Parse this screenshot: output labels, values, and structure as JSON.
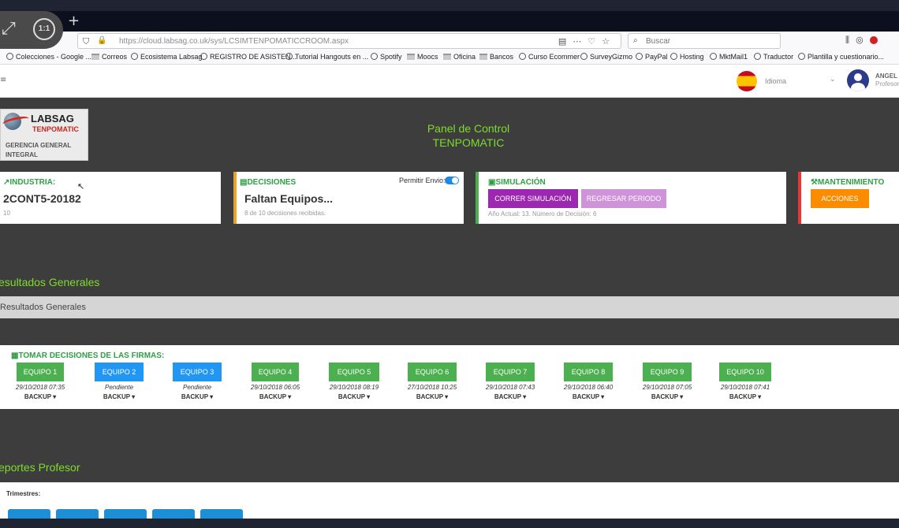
{
  "browser": {
    "url": "https://cloud.labsag.co.uk/sys/LCSIMTENPOMATICCROOM.aspx",
    "search_placeholder": "Buscar",
    "viewer_zoom": "1:1",
    "bookmarks": [
      "Colecciones - Google ...",
      "Correos",
      "Ecosistema Labsag",
      "REGISTRO DE ASISTEN...",
      "Tutorial Hangouts en ...",
      "Spotify",
      "Moocs",
      "Oficina",
      "Bancos",
      "Curso Ecommer",
      "SurveyGizmo",
      "PayPal",
      "Hosting",
      "MktMail1",
      "Traductor",
      "Plantilla y cuestionario..."
    ]
  },
  "header": {
    "language_label": "Idioma",
    "user_name": "ANGEL",
    "user_role": "Profesor"
  },
  "logo": {
    "brand": "LABSAG",
    "sub": "TENPOMATIC",
    "line1": "GERENCIA GENERAL",
    "line2": "INTEGRAL"
  },
  "panel": {
    "line1": "Panel de Control",
    "line2": "TENPOMATIC"
  },
  "cards": {
    "industria": {
      "title": "INDUSTRIA:",
      "value": "2CONT5-20182",
      "sub": "10"
    },
    "decisiones": {
      "title": "DECISIONES",
      "value": "Faltan Equipos...",
      "sub": "8 de 10 decisiones recibidas.",
      "toggle_label": "Permitir Envio:"
    },
    "simulacion": {
      "title": "SIMULACIÓN",
      "run_label": "CORRER SIMULACIÓN",
      "back_label": "REGRESAR PERIODO",
      "note": "Año Actual: 13. Número de Decisión: 6"
    },
    "mantenimiento": {
      "title": "MANTENIMIENTO",
      "action_label": "ACCIONES"
    }
  },
  "resultados": {
    "heading": "esultados Generales",
    "bar_label": "Resultados Generales"
  },
  "decisions_panel": {
    "title": "TOMAR DECISIONES DE LAS FIRMAS:",
    "backup_label": "BACKUP",
    "teams": [
      {
        "label": "EQUIPO 1",
        "status": "29/10/2018 07:35",
        "color": "#4caf50"
      },
      {
        "label": "EQUIPO 2",
        "status": "Pendiente",
        "color": "#2196f3"
      },
      {
        "label": "EQUIPO 3",
        "status": "Pendiente",
        "color": "#2196f3"
      },
      {
        "label": "EQUIPO 4",
        "status": "29/10/2018 06:05",
        "color": "#4caf50"
      },
      {
        "label": "EQUIPO 5",
        "status": "29/10/2018 08:19",
        "color": "#4caf50"
      },
      {
        "label": "EQUIPO 6",
        "status": "27/10/2018 10:25",
        "color": "#4caf50"
      },
      {
        "label": "EQUIPO 7",
        "status": "29/10/2018 07:43",
        "color": "#4caf50"
      },
      {
        "label": "EQUIPO 8",
        "status": "29/10/2018 06:40",
        "color": "#4caf50"
      },
      {
        "label": "EQUIPO 9",
        "status": "29/10/2018 07:05",
        "color": "#4caf50"
      },
      {
        "label": "EQUIPO 10",
        "status": "29/10/2018 07:41",
        "color": "#4caf50"
      }
    ]
  },
  "reportes": {
    "heading": "eportes Profesor",
    "trimestres_label": "Trimestres:"
  },
  "colors": {
    "accent_green": "#7ddc2b",
    "section_green": "#2f9e44",
    "purple": "#9c27b0",
    "orange": "#fb8c00"
  }
}
